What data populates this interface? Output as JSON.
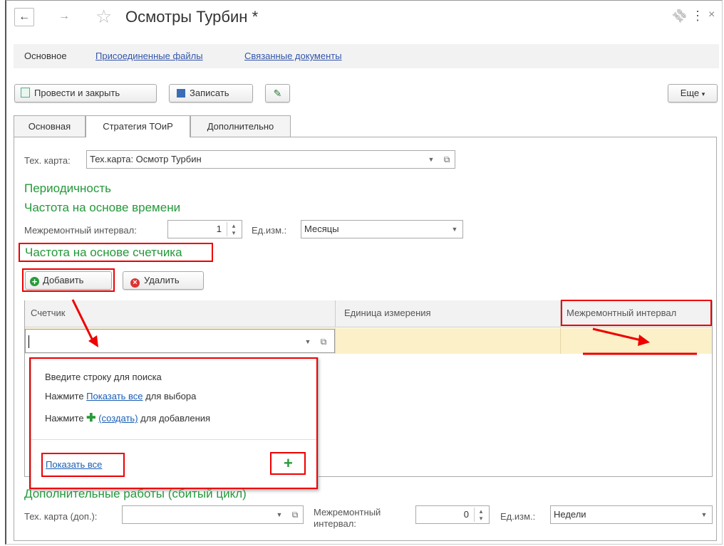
{
  "window": {
    "title": "Осмотры Турбин *",
    "back_icon": "←",
    "forward_icon": "→",
    "star_icon": "☆",
    "link_icon": "⛓",
    "menu_icon": "⋮",
    "close_icon": "×"
  },
  "nav_tabs": {
    "main": "Основное",
    "files": "Присоединенные файлы",
    "docs": "Связанные документы"
  },
  "toolbar": {
    "post_close": "Провести и закрыть",
    "save": "Записать",
    "more": "Еще"
  },
  "tabs": {
    "main": "Основная",
    "strategy": "Стратегия ТОиР",
    "additional": "Дополнительно"
  },
  "tech_card": {
    "label": "Тех. карта:",
    "value": "Тех.карта: Осмотр Турбин"
  },
  "periodicity": {
    "heading": "Периодичность",
    "time_heading": "Частота на основе времени",
    "interval_label": "Межремонтный интервал:",
    "interval_value": "1",
    "unit_label": "Ед.изм.:",
    "unit_value": "Месяцы"
  },
  "counter_section": {
    "heading": "Частота на основе счетчика",
    "add": "Добавить",
    "remove": "Удалить"
  },
  "grid": {
    "columns": [
      "Счетчик",
      "Единица измерения",
      "Межремонтный интервал"
    ],
    "row_value": ""
  },
  "popup": {
    "line1": "Введите строку для поиска",
    "line2_prefix": "Нажмите ",
    "line2_link": "Показать все",
    "line2_suffix": " для выбора",
    "line3_prefix": "Нажмите ",
    "line3_link": "(создать)",
    "line3_suffix": " для добавления",
    "show_all": "Показать все",
    "plus": "+"
  },
  "extra_works": {
    "heading": "Дополнительные работы (сбитый цикл)",
    "card_label": "Тех. карта (доп.):",
    "card_value": "",
    "interval_label_1": "Межремонтный",
    "interval_label_2": "интервал:",
    "interval_value": "0",
    "unit_label": "Ед.изм.:",
    "unit_value": "Недели"
  },
  "colors": {
    "green": "#24993a",
    "red_annotation": "#e00000",
    "row_highlight": "#fbf0c8",
    "link": "#1a5fb4"
  }
}
